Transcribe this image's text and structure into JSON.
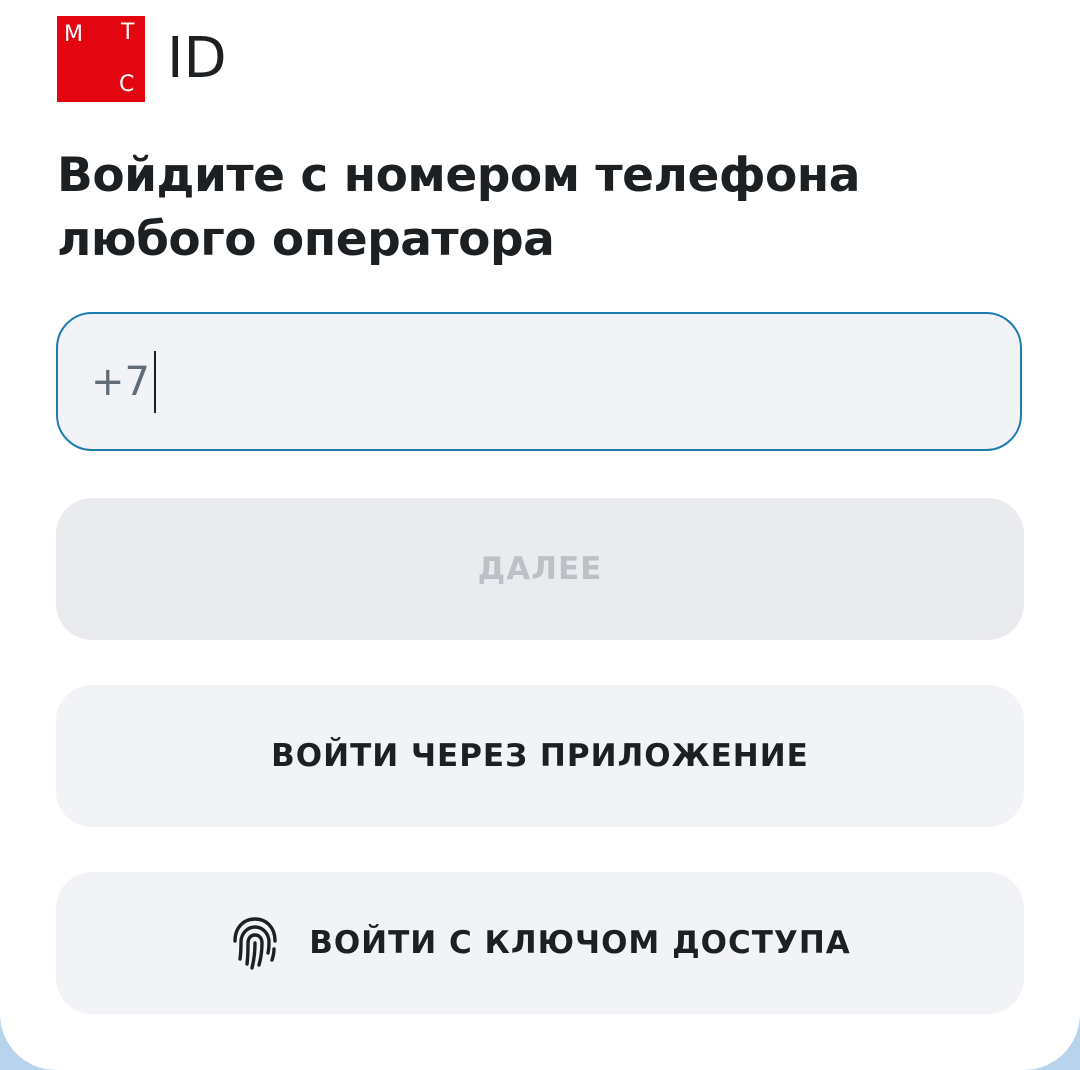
{
  "logo": {
    "letters": [
      "М",
      "Т",
      "С"
    ],
    "suffix": "ID",
    "brand_color": "#e30611"
  },
  "heading": "Войдите с номером телефона любого оператора",
  "phone_input": {
    "prefix": "+7",
    "value": ""
  },
  "buttons": {
    "next": "ДАЛЕЕ",
    "app_login": "ВОЙТИ ЧЕРЕЗ ПРИЛОЖЕНИЕ",
    "passkey_login": "ВОЙТИ С КЛЮЧОМ ДОСТУПА"
  },
  "icons": {
    "passkey": "fingerprint-icon"
  },
  "colors": {
    "accent_border": "#1d7bb0",
    "text_primary": "#1d2023",
    "text_disabled": "#bbc1c7",
    "field_bg": "#f2f3f7",
    "page_bg": "#b8d3ec"
  }
}
